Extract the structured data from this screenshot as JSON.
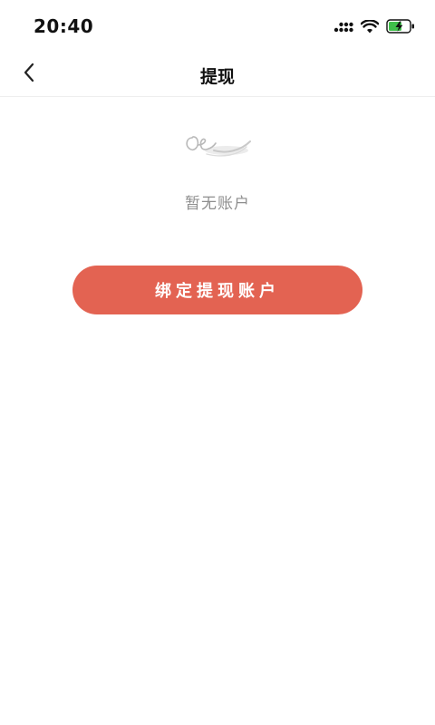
{
  "status_bar": {
    "time": "20:40",
    "icons": [
      "signal-icon",
      "wifi-icon",
      "battery-charging-icon"
    ],
    "battery_color": "#3fbf4a"
  },
  "nav": {
    "back_icon": "chevron-left-icon",
    "title": "提现"
  },
  "empty_state": {
    "icon": "empty-scribble-icon",
    "message": "暂无账户"
  },
  "actions": {
    "bind_button_label": "绑定提现账户",
    "bind_button_color": "#e36352"
  }
}
